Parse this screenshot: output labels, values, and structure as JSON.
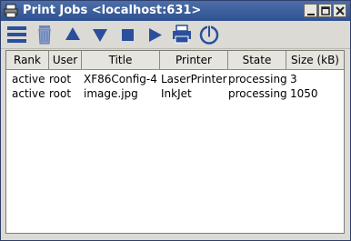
{
  "window": {
    "title": "Print Jobs <localhost:631>",
    "buttons": [
      "minimize",
      "maximize",
      "close"
    ]
  },
  "toolbar": {
    "icons": [
      "job-list-icon",
      "trash-icon",
      "move-up-icon",
      "move-down-icon",
      "stop-icon",
      "play-icon",
      "printer-icon",
      "power-icon"
    ]
  },
  "table": {
    "columns": [
      "Rank",
      "User",
      "Title",
      "Printer",
      "State",
      "Size (kB)"
    ],
    "rows": [
      [
        "active",
        "root",
        "XF86Config-4",
        "LaserPrinter",
        "processing",
        "3"
      ],
      [
        "active",
        "root",
        "image.jpg",
        "InkJet",
        "processing",
        "1050"
      ]
    ]
  },
  "colors": {
    "titlebar": "#3a5c9d",
    "toolbar_icon": "#2a4f9c",
    "window_bg": "#dcdad5"
  }
}
